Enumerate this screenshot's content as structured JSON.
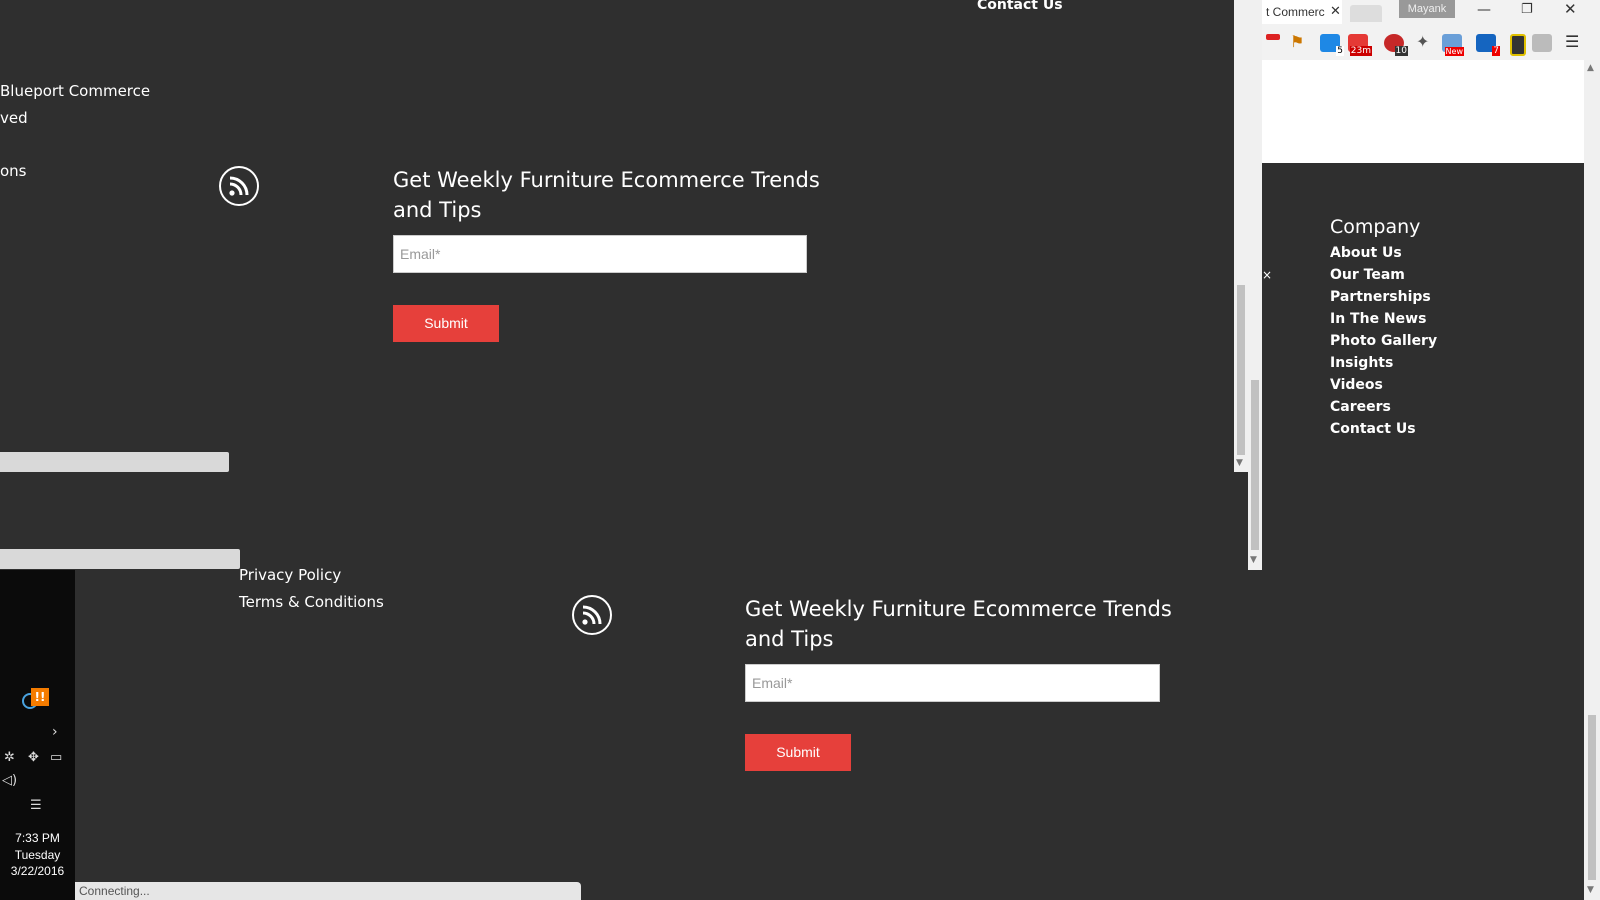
{
  "background_page": {
    "top_contact": "Contact Us",
    "left_fragments": [
      "Blueport Commerce",
      "ved",
      "ons"
    ],
    "newsletter": {
      "title_line1": "Get Weekly Furniture Ecommerce Trends",
      "title_line2": "and Tips",
      "email_placeholder": "Email*",
      "submit_label": "Submit"
    }
  },
  "footer": {
    "links": [
      "Privacy Policy",
      "Terms & Conditions"
    ],
    "newsletter": {
      "title_line1": "Get Weekly Furniture Ecommerce Trends",
      "title_line2": "and Tips",
      "email_placeholder": "Email*",
      "submit_label": "Submit"
    }
  },
  "browser": {
    "tab_title": "t Commerc",
    "user": "Mayank",
    "extension_badges": [
      "5",
      "23m",
      "10",
      "New",
      "7"
    ],
    "icons": [
      "minimize-icon",
      "restore-icon",
      "close-icon",
      "menu-icon"
    ]
  },
  "company": {
    "heading": "Company",
    "links": [
      "About Us",
      "Our Team",
      "Partnerships",
      "In The News",
      "Photo Gallery",
      "Insights",
      "Videos",
      "Careers",
      "Contact Us"
    ]
  },
  "taskbar": {
    "time": "7:33 PM",
    "day": "Tuesday",
    "date": "3/22/2016"
  },
  "status_bar": {
    "text": "Connecting..."
  },
  "colors": {
    "background": "#2f2f2f",
    "accent": "#e6403b"
  }
}
